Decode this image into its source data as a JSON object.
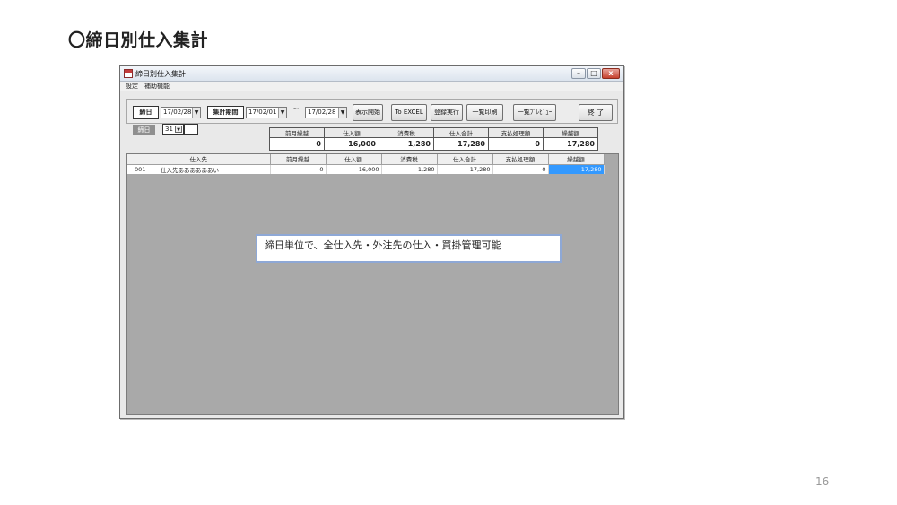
{
  "slide": {
    "title": "〇締日別仕入集計",
    "page_number": "16",
    "callout": "締日単位で、全仕入先・外注先の仕入・買掛管理可能"
  },
  "window": {
    "title": "締日別仕入集計",
    "menu": [
      "設定",
      "補助機能"
    ],
    "controls": {
      "minimize": "–",
      "maximize": "□",
      "close": "x"
    }
  },
  "toolbar": {
    "shime_label": "締日",
    "shime_date": "17/02/28",
    "period_label": "集計期間",
    "period_from": "17/02/01",
    "tilde": "~",
    "period_to": "17/02/28",
    "buttons": {
      "display": "表示開始",
      "excel": "To EXCEL",
      "register": "登録実行",
      "print": "一覧印刷",
      "preview": "一覧ﾌﾟﾚﾋﾞｭｰ",
      "exit": "終 了"
    }
  },
  "filter": {
    "label": "締日",
    "day": "31"
  },
  "summary": {
    "headers": [
      "前月繰越",
      "仕入額",
      "消費税",
      "仕入合計",
      "支払処理額",
      "繰越額"
    ],
    "values": [
      "0",
      "16,000",
      "1,280",
      "17,280",
      "0",
      "17,280"
    ]
  },
  "grid": {
    "headers": [
      "仕入先",
      "前月繰越",
      "仕入額",
      "消費税",
      "仕入合計",
      "支払処理額",
      "繰越額"
    ],
    "row": {
      "code": "001",
      "name": "仕入先ああああああい",
      "values": [
        "0",
        "16,000",
        "1,280",
        "17,280",
        "0",
        "17,280"
      ]
    }
  },
  "colors": {
    "selection": "#3399ff",
    "grid_background": "#a9a9a9",
    "callout_border": "#8ea8d6"
  }
}
